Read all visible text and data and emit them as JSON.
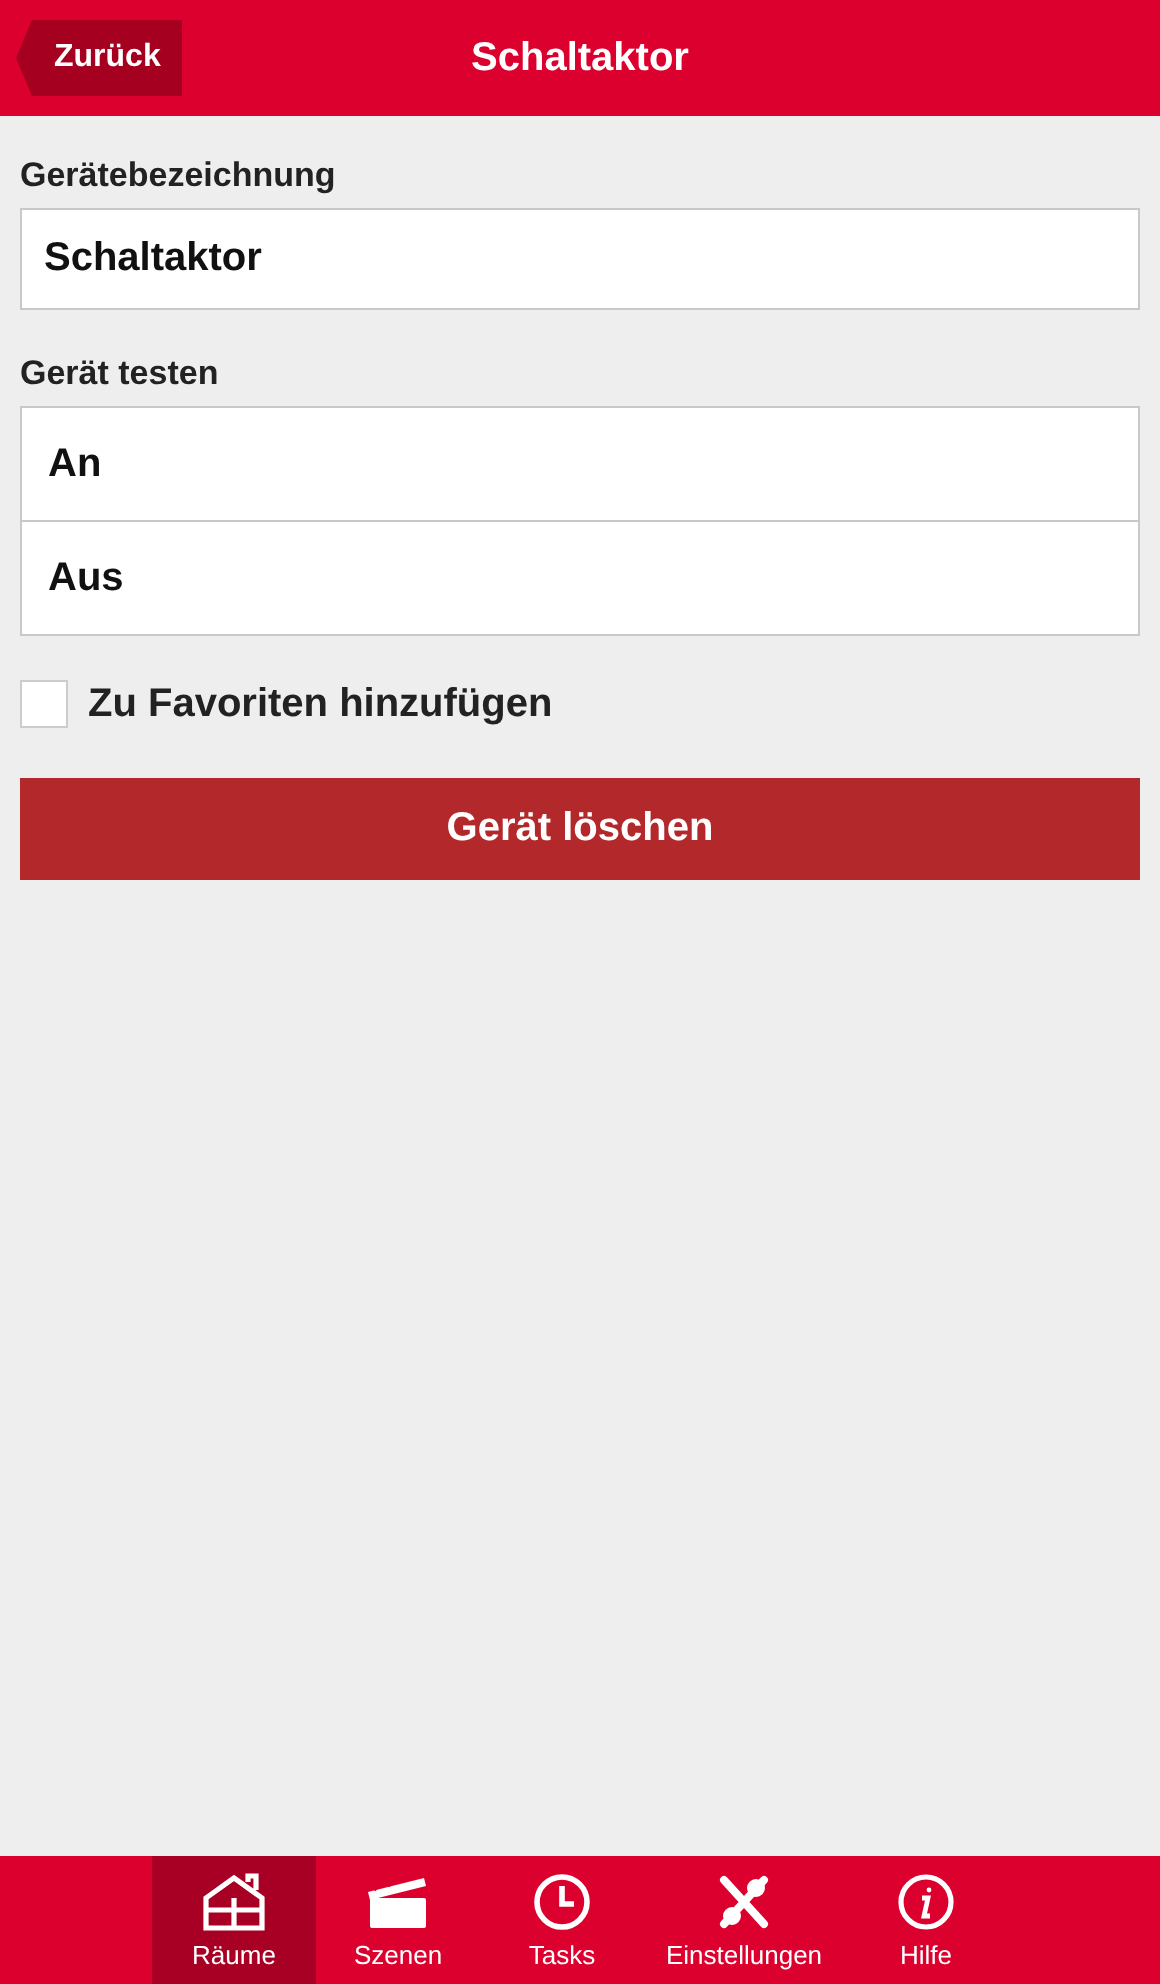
{
  "header": {
    "back_button": "Zurück",
    "title": "Schaltaktor"
  },
  "name_field": {
    "label": "Gerätebezeichnung",
    "value": "Schaltaktor"
  },
  "test": {
    "label": "Gerät testen",
    "options": [
      "An",
      "Aus"
    ]
  },
  "favorite": {
    "label": "Zu Favoriten hinzufügen",
    "checked": false
  },
  "delete_button": "Gerät löschen",
  "nav": [
    {
      "label": "Räume",
      "selected": true
    },
    {
      "label": "Szenen",
      "selected": false
    },
    {
      "label": "Tasks",
      "selected": false
    },
    {
      "label": "Einstellungen",
      "selected": false
    },
    {
      "label": "Hilfe",
      "selected": false
    }
  ]
}
